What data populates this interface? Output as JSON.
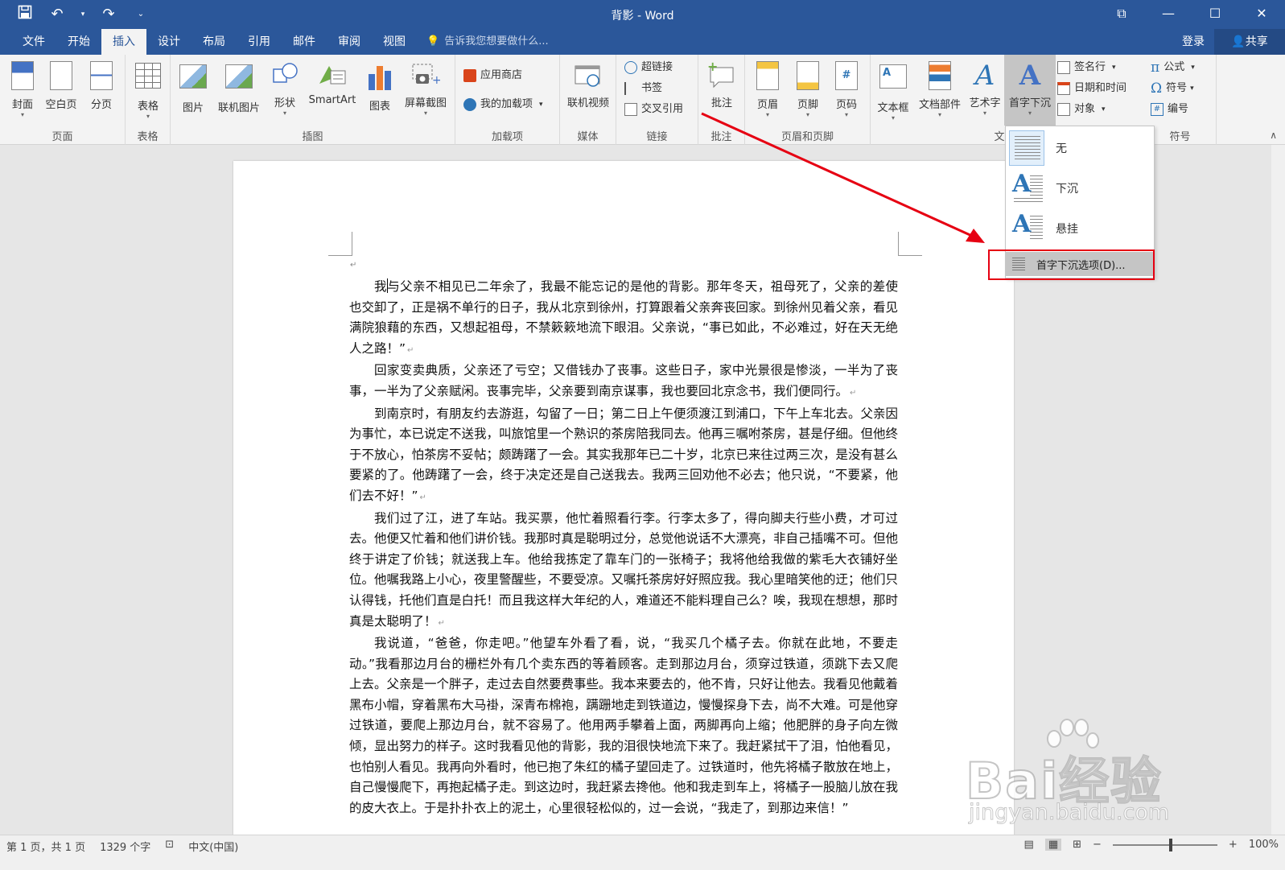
{
  "window": {
    "title": "背影 - Word"
  },
  "qat": {
    "save": "save-icon",
    "undo": "undo-icon",
    "redo": "redo-icon",
    "customize": "customize-icon"
  },
  "tabs": [
    "文件",
    "开始",
    "插入",
    "设计",
    "布局",
    "引用",
    "邮件",
    "审阅",
    "视图"
  ],
  "active_tab": "插入",
  "tell_me": "告诉我您想要做什么...",
  "account": {
    "login": "登录",
    "share": "共享"
  },
  "ribbon": {
    "groups": {
      "pages": "页面",
      "tables": "表格",
      "illustrations": "插图",
      "addins": "加载项",
      "media": "媒体",
      "links": "链接",
      "comments": "批注",
      "header_footer": "页眉和页脚",
      "text": "文",
      "symbols": "符号"
    },
    "buttons": {
      "cover": "封面",
      "blank": "空白页",
      "break": "分页",
      "table": "表格",
      "picture": "图片",
      "online_picture": "联机图片",
      "shapes": "形状",
      "smartart": "SmartArt",
      "chart": "图表",
      "screenshot": "屏幕截图",
      "store": "应用商店",
      "my_addins": "我的加载项",
      "online_video": "联机视频",
      "hyperlink": "超链接",
      "bookmark": "书签",
      "cross_ref": "交叉引用",
      "comment": "批注",
      "header": "页眉",
      "footer": "页脚",
      "page_number": "页码",
      "textbox": "文本框",
      "quick_parts": "文档部件",
      "wordart": "艺术字",
      "dropcap": "首字下沉",
      "signature": "签名行",
      "datetime": "日期和时间",
      "object": "对象",
      "equation": "公式",
      "symbol": "符号",
      "numbering": "编号"
    }
  },
  "dropcap_menu": {
    "none": "无",
    "dropped": "下沉",
    "margin": "悬挂",
    "options": "首字下沉选项(D)..."
  },
  "document": {
    "paragraphs": [
      {
        "pre": "我",
        "post": "与父亲不相见已二年余了，我最不能忘记的是他的背影。那年冬天，祖母死了，父亲的差使也交卸了，正是祸不单行的日子，我从北京到徐州，打算跟着父亲奔丧回家。到徐州见着父亲，看见满院狼藉的东西，又想起祖母，不禁簌簌地流下眼泪。父亲说，“事已如此，不必难过，好在天无绝人之路！”"
      },
      {
        "text": "回家变卖典质，父亲还了亏空；又借钱办了丧事。这些日子，家中光景很是惨淡，一半为了丧事，一半为了父亲赋闲。丧事完毕，父亲要到南京谋事，我也要回北京念书，我们便同行。"
      },
      {
        "text": "到南京时，有朋友约去游逛，勾留了一日；第二日上午便须渡江到浦口，下午上车北去。父亲因为事忙，本已说定不送我，叫旅馆里一个熟识的茶房陪我同去。他再三嘱咐茶房，甚是仔细。但他终于不放心，怕茶房不妥帖；颇踌躇了一会。其实我那年已二十岁，北京已来往过两三次，是没有甚么要紧的了。他踌躇了一会，终于决定还是自己送我去。我两三回劝他不必去；他只说，“不要紧，他们去不好！”"
      },
      {
        "text": "我们过了江，进了车站。我买票，他忙着照看行李。行李太多了，得向脚夫行些小费，才可过去。他便又忙着和他们讲价钱。我那时真是聪明过分，总觉他说话不大漂亮，非自己插嘴不可。但他终于讲定了价钱；就送我上车。他给我拣定了靠车门的一张椅子；我将他给我做的紫毛大衣铺好坐位。他嘱我路上小心，夜里警醒些，不要受凉。又嘱托茶房好好照应我。我心里暗笑他的迂；他们只认得钱，托他们直是白托！而且我这样大年纪的人，难道还不能料理自己么？唉，我现在想想，那时真是太聪明了！"
      },
      {
        "text": "我说道，“爸爸，你走吧。”他望车外看了看，说，“我买几个橘子去。你就在此地，不要走动。”我看那边月台的栅栏外有几个卖东西的等着顾客。走到那边月台，须穿过铁道，须跳下去又爬上去。父亲是一个胖子，走过去自然要费事些。我本来要去的，他不肯，只好让他去。我看见他戴着黑布小帽，穿着黑布大马褂，深青布棉袍，蹒跚地走到铁道边，慢慢探身下去，尚不大难。可是他穿过铁道，要爬上那边月台，就不容易了。他用两手攀着上面，两脚再向上缩；他肥胖的身子向左微倾，显出努力的样子。这时我看见他的背影，我的泪很快地流下来了。我赶紧拭干了泪，怕他看见，也怕别人看见。我再向外看时，他已抱了朱红的橘子望回走了。过铁道时，他先将橘子散放在地上，自己慢慢爬下，再抱起橘子走。到这边时，我赶紧去搀他。他和我走到车上，将橘子一股脑儿放在我的皮大衣上。于是扑扑衣上的泥土，心里很轻松似的，过一会说，“我走了，到那边来信！”"
      }
    ]
  },
  "status": {
    "page": "第 1 页，共 1 页",
    "words": "1329 个字",
    "lang": "中文(中国)",
    "zoom": "100%",
    "zoom_level": 100
  },
  "watermark": {
    "brand": "Bai经验",
    "url": "jingyan.baidu.com"
  },
  "colors": {
    "accent": "#2b579a",
    "annotation": "#e60012"
  }
}
